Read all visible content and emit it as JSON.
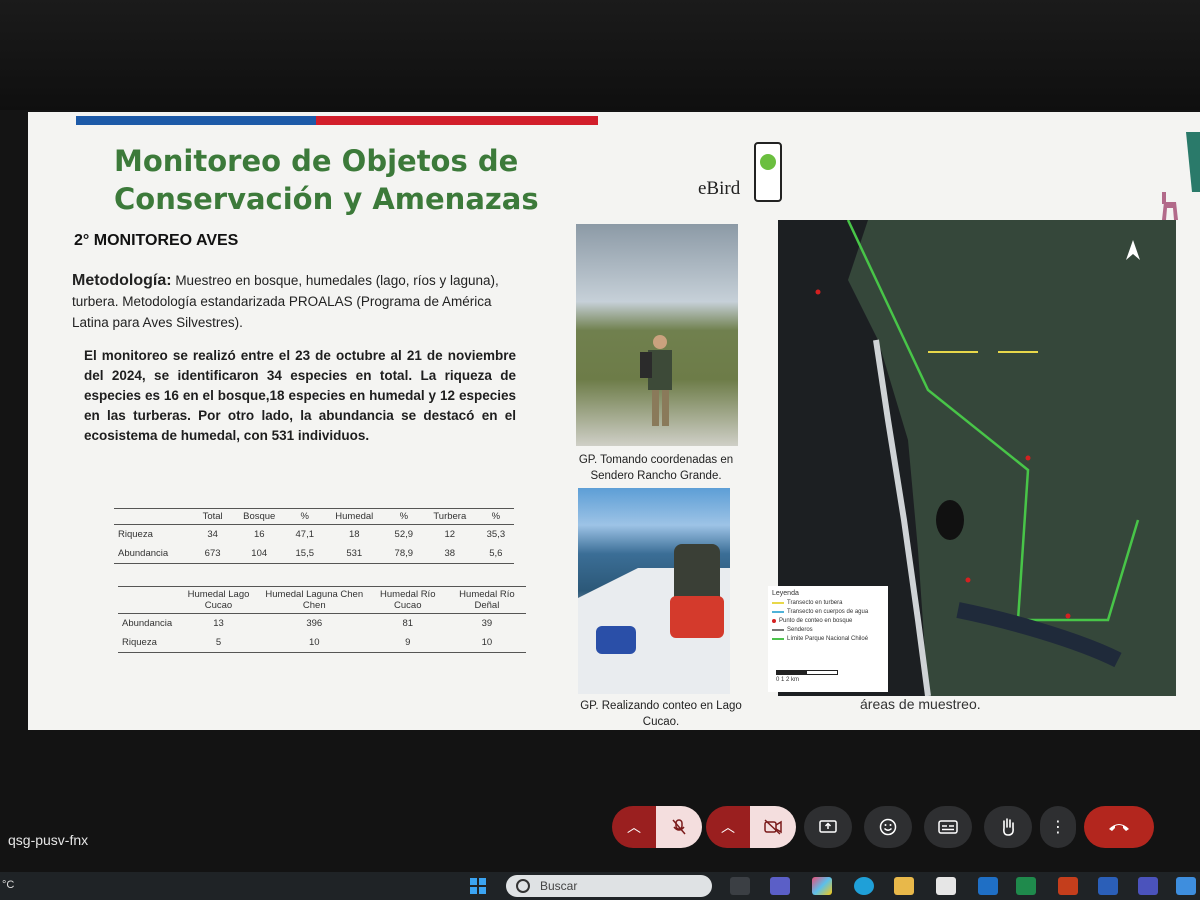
{
  "slide": {
    "title_line1": "Monitoreo de Objetos de",
    "title_line2": "Conservación y Amenazas",
    "logo_text": "eBird",
    "subtitle": "2° MONITOREO AVES",
    "method_label": "Metodología:",
    "method_text": "Muestreo en bosque, humedales (lago, ríos y laguna), turbera. Metodología estandarizada PROALAS (Programa de América Latina para Aves Silvestres).",
    "summary_text": "El monitoreo se realizó entre el 23 de octubre al 21 de noviembre del 2024, se identificaron 34 especies en total. La riqueza de especies es 16 en el bosque,18 especies en humedal y 12 especies en las turberas. Por otro lado, la abundancia se destacó en el ecosistema de humedal, con 531 individuos.",
    "table1": {
      "headers": [
        "",
        "Total",
        "Bosque",
        "%",
        "Humedal",
        "%",
        "Turbera",
        "%"
      ],
      "rows": [
        [
          "Riqueza",
          "34",
          "16",
          "47,1",
          "18",
          "52,9",
          "12",
          "35,3"
        ],
        [
          "Abundancia",
          "673",
          "104",
          "15,5",
          "531",
          "78,9",
          "38",
          "5,6"
        ]
      ]
    },
    "table2": {
      "headers": [
        "",
        "Humedal Lago Cucao",
        "Humedal Laguna Chen Chen",
        "Humedal Río Cucao",
        "Humedal Río Deñal"
      ],
      "rows": [
        [
          "Abundancia",
          "13",
          "396",
          "81",
          "39"
        ],
        [
          "Riqueza",
          "5",
          "10",
          "9",
          "10"
        ]
      ]
    },
    "photo1_caption": "GP. Tomando coordenadas en Sendero Rancho Grande.",
    "photo2_caption": "GP. Realizando conteo en Lago Cucao.",
    "map_caption": "áreas de muestreo.",
    "legend": {
      "title": "Leyenda",
      "items": [
        {
          "label": "Transecto en turbera",
          "color": "#e8d84a"
        },
        {
          "label": "Transecto en cuerpos de agua",
          "color": "#4fb2d8"
        },
        {
          "label": "Punto de conteo en bosque",
          "color": "#d42020"
        },
        {
          "label": "Senderos",
          "color": "#777777"
        },
        {
          "label": "Límite Parque Nacional Chiloé",
          "color": "#4cc24c"
        }
      ],
      "scale_label": "0    1    2 km"
    }
  },
  "meet": {
    "meeting_code": "qsg-pusv-fnx",
    "controls": [
      {
        "name": "mic-options",
        "icon": "^"
      },
      {
        "name": "mic-muted",
        "icon": "mic-off"
      },
      {
        "name": "camera-options",
        "icon": "^"
      },
      {
        "name": "camera-off",
        "icon": "cam-off"
      },
      {
        "name": "present",
        "icon": "present"
      },
      {
        "name": "reactions",
        "icon": "emoji"
      },
      {
        "name": "captions",
        "icon": "cc"
      },
      {
        "name": "raise-hand",
        "icon": "hand"
      },
      {
        "name": "more-options",
        "icon": "⋮"
      },
      {
        "name": "leave-call",
        "icon": "phone-down"
      }
    ]
  },
  "taskbar": {
    "temperature": "°C",
    "search_placeholder": "Buscar"
  },
  "colors": {
    "title_green": "#3c7a3a",
    "flag_blue": "#1d5aa8",
    "flag_red": "#d21e2b",
    "leave_red": "#b3261e"
  }
}
